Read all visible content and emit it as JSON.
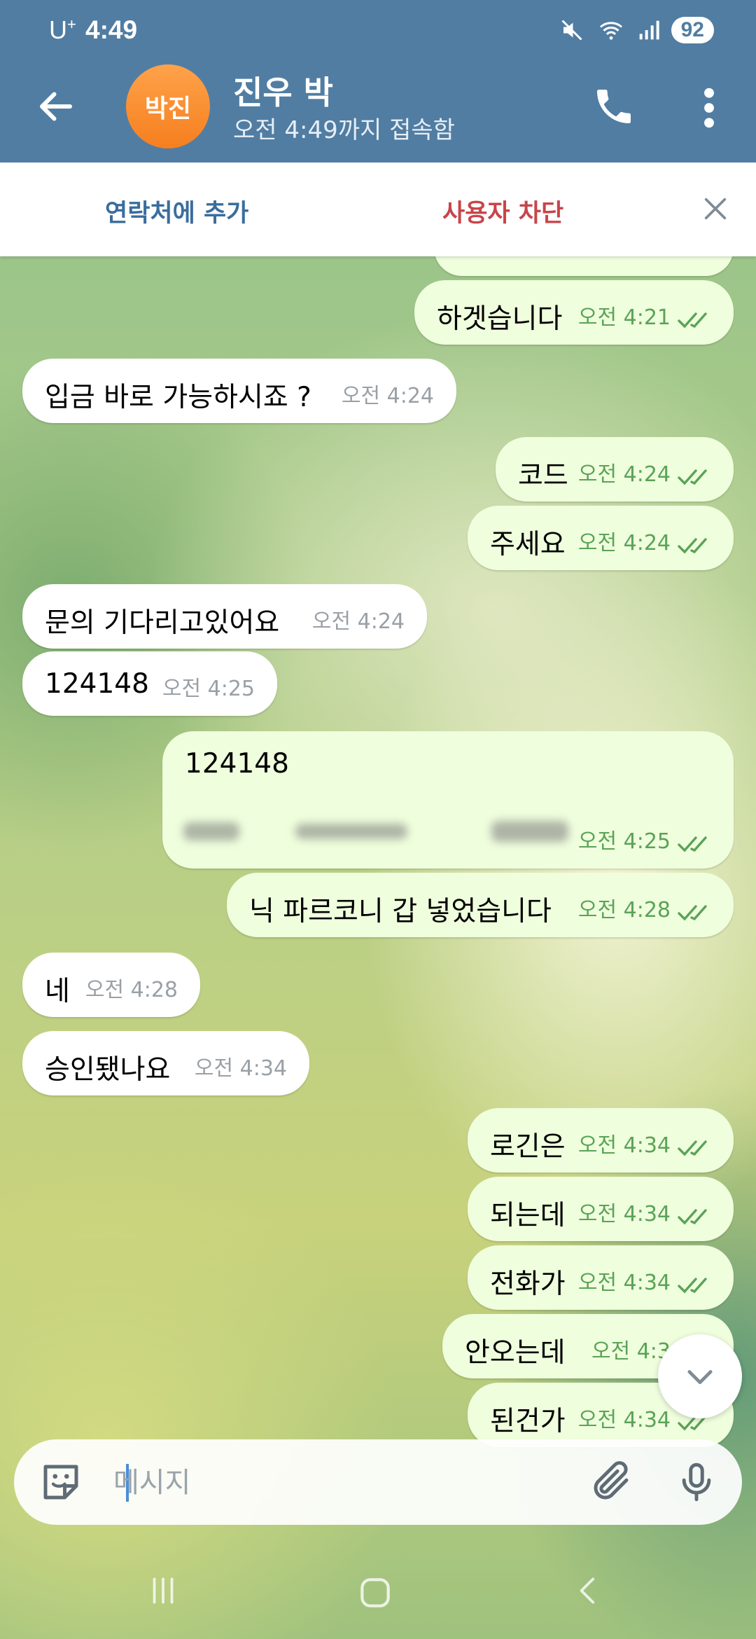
{
  "status_bar": {
    "carrier": "U",
    "carrier_sup": "+",
    "time": "4:49",
    "battery": "92"
  },
  "header": {
    "avatar_initials": "박진",
    "contact_name": "진우 박",
    "last_seen": "오전 4:49까지 접속함"
  },
  "action_bar": {
    "add_contact": "연락처에 추가",
    "block_user": "사용자 차단"
  },
  "messages": [
    {
      "dir": "out",
      "text": "하겟습니다",
      "time": "오전 4:21"
    },
    {
      "dir": "in",
      "text": "입금 바로 가능하시죠 ?",
      "time": "오전 4:24"
    },
    {
      "dir": "out",
      "text": "코드",
      "time": "오전 4:24"
    },
    {
      "dir": "out",
      "text": "주세요",
      "time": "오전 4:24"
    },
    {
      "dir": "in",
      "text": "문의 기다리고있어요",
      "time": "오전 4:24"
    },
    {
      "dir": "in",
      "text": "124148",
      "time": "오전 4:25"
    },
    {
      "dir": "out",
      "text": "124148",
      "time": "오전 4:25"
    },
    {
      "dir": "out",
      "text": "닉 파르코니 갑 넣었습니다",
      "time": "오전 4:28"
    },
    {
      "dir": "in",
      "text": "네",
      "time": "오전 4:28"
    },
    {
      "dir": "in",
      "text": "승인됐나요",
      "time": "오전 4:34"
    },
    {
      "dir": "out",
      "text": "로긴은",
      "time": "오전 4:34"
    },
    {
      "dir": "out",
      "text": "되는데",
      "time": "오전 4:34"
    },
    {
      "dir": "out",
      "text": "전화가",
      "time": "오전 4:34"
    },
    {
      "dir": "out",
      "text": "안오는데",
      "time": "오전 4:3"
    },
    {
      "dir": "out",
      "text": "된건가",
      "time": "오전 4:34"
    }
  ],
  "input": {
    "placeholder": "메시지"
  },
  "colors": {
    "header": "#517da2",
    "outgoing_bubble": "#effedd",
    "incoming_bubble": "#ffffff",
    "block_red": "#c8454a",
    "add_blue": "#3a6d9e",
    "avatar_orange": "#f57f1f"
  }
}
